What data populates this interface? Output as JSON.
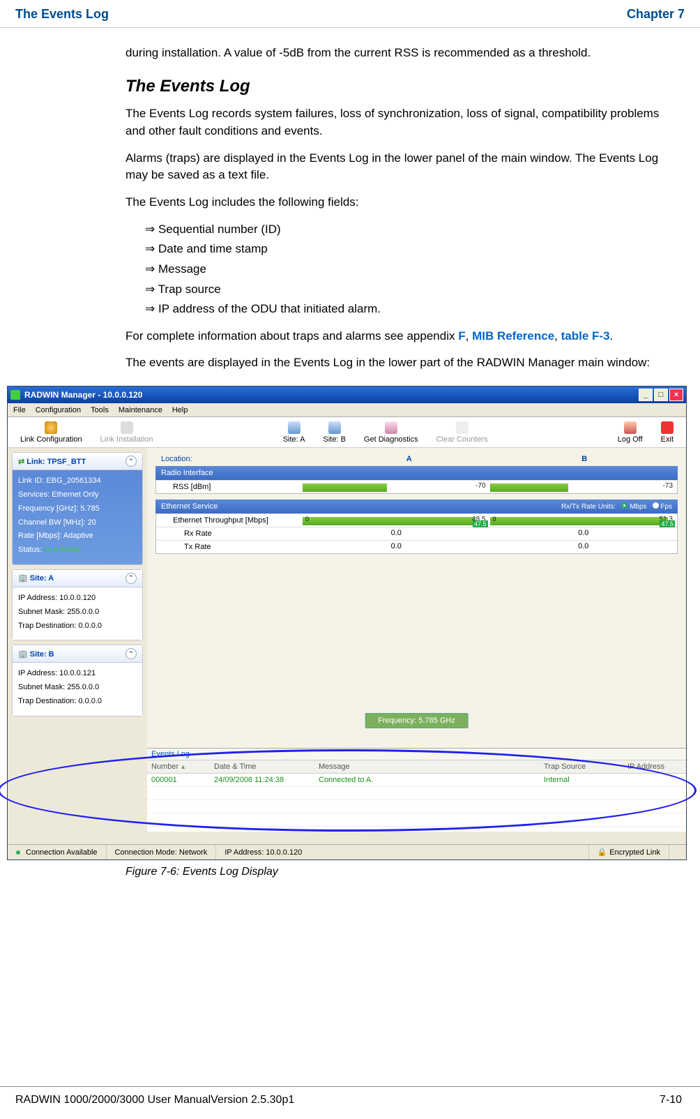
{
  "header": {
    "left": "The Events Log",
    "right": "Chapter 7"
  },
  "intro_continuation": "during installation. A value of -5dB from the current RSS is recommended as a threshold.",
  "section_heading": "The Events Log",
  "para1": "The Events Log records system failures, loss of synchronization, loss of signal, compatibility problems and other fault conditions and events.",
  "para2": "Alarms (traps) are displayed in the Events Log in the lower panel of the main window. The Events Log may be saved as a text file.",
  "para3": "The Events Log includes the following fields:",
  "bullets": [
    "Sequential number (ID)",
    "Date and time stamp",
    "Message",
    "Trap source",
    "IP address of the ODU that initiated alarm."
  ],
  "para4_pre": "For complete information about traps and alarms see appendix ",
  "para4_link1": "F",
  "para4_mid": ", ",
  "para4_link2": "MIB Reference",
  "para4_mid2": ", ",
  "para4_link3": "table F-3",
  "para4_end": ".",
  "para5": "The events are displayed in the Events Log in the lower part of the RADWIN Manager main window:",
  "figure_caption": "Figure 7-6: Events Log Display",
  "footer": {
    "left": "RADWIN 1000/2000/3000 User ManualVersion  2.5.30p1",
    "right": "7-10"
  },
  "app": {
    "title": "RADWIN Manager - 10.0.0.120",
    "menus": [
      "File",
      "Configuration",
      "Tools",
      "Maintenance",
      "Help"
    ],
    "toolbar": [
      {
        "label": "Link Configuration",
        "disabled": false
      },
      {
        "label": "Link Installation",
        "disabled": true
      },
      {
        "label": "Site: A",
        "disabled": false
      },
      {
        "label": "Site: B",
        "disabled": false
      },
      {
        "label": "Get Diagnostics",
        "disabled": false
      },
      {
        "label": "Clear Counters",
        "disabled": true
      },
      {
        "label": "Log Off",
        "disabled": false
      },
      {
        "label": "Exit",
        "disabled": false
      }
    ],
    "link_panel": {
      "title": "Link: TPSF_BTT",
      "rows": [
        "Link ID:  EBG_20561334",
        "Services:  Ethernet Only",
        "Frequency [GHz]:  5.785",
        "Channel BW [MHz]:  20",
        "Rate [Mbps]:  Adaptive"
      ],
      "status_label": "Status:",
      "status_value": "Link Active"
    },
    "siteA": {
      "title": "Site: A",
      "rows": [
        "IP Address:  10.0.0.120",
        "Subnet Mask:  255.0.0.0",
        "Trap Destination:  0.0.0.0"
      ]
    },
    "siteB": {
      "title": "Site: B",
      "rows": [
        "IP Address:  10.0.0.121",
        "Subnet Mask:  255.0.0.0",
        "Trap Destination:  0.0.0.0"
      ]
    },
    "location_label": "Location:",
    "colA": "A",
    "colB": "B",
    "radio_section": "Radio Interface",
    "rss_label": "RSS [dBm]",
    "rss_a": "-70",
    "rss_b": "-73",
    "eth_section": "Ethernet Service",
    "rate_units_label": "Rx/Tx Rate Units:",
    "unit_mbps": "Mbps",
    "unit_fps": "Fps",
    "eth_throughput": "Ethernet Throughput [Mbps]",
    "tp_a": "48.5",
    "tp_a_mini": "47.5",
    "tp_b": "51.3",
    "tp_b_mini": "47.5",
    "rx_rate": "Rx Rate",
    "rx_a": "0.0",
    "rx_b": "0.0",
    "tx_rate": "Tx Rate",
    "tx_a": "0.0",
    "tx_b": "0.0",
    "freq_badge": "Frequency: 5.785 GHz",
    "events_log_title": "Events Log",
    "log_headers": [
      "Number",
      "Date & Time",
      "Message",
      "Trap Source",
      "IP Address"
    ],
    "log_row": {
      "num": "000001",
      "dt": "24/09/2008 11:24:38",
      "msg": "Connected to A.",
      "src": "Internal",
      "ip": ""
    },
    "statusbar": {
      "conn": "Connection Available",
      "mode": "Connection Mode: Network",
      "ip": "IP Address: 10.0.0.120",
      "enc": "Encrypted Link"
    }
  }
}
